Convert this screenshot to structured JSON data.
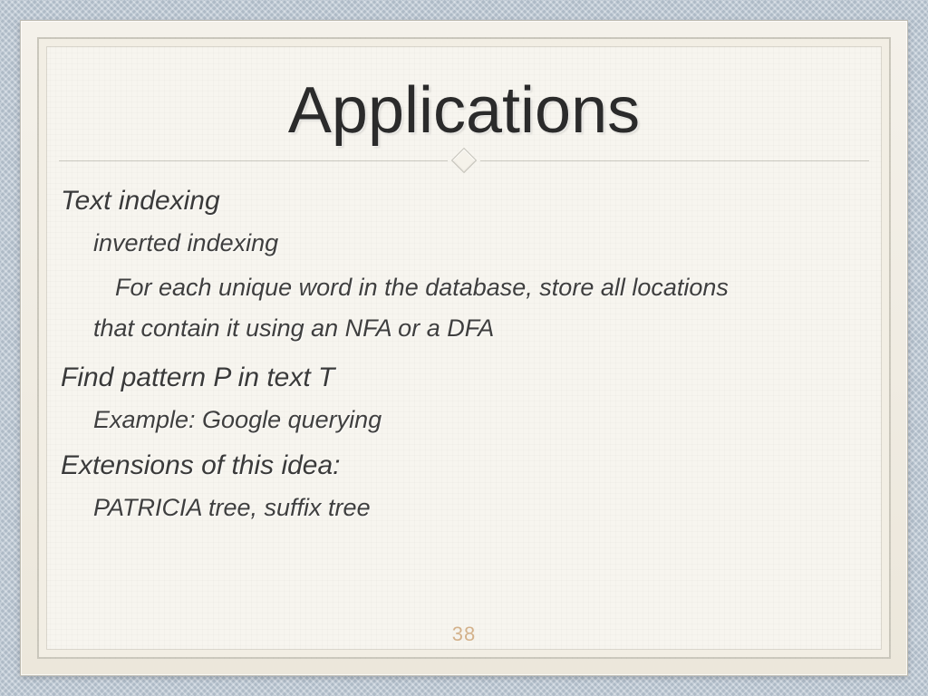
{
  "title": "Applications",
  "sections": {
    "text_indexing": {
      "heading": "Text indexing",
      "sub1": "inverted indexing",
      "para_line1": "For each unique word in the database, store all locations",
      "para_line2": "that contain it using an NFA or a DFA"
    },
    "find_pattern": {
      "heading": "Find pattern P in text T",
      "example": "Example: Google querying"
    },
    "extensions": {
      "heading": "Extensions of this idea:",
      "item": "PATRICIA tree, suffix tree"
    }
  },
  "page_number": "38"
}
